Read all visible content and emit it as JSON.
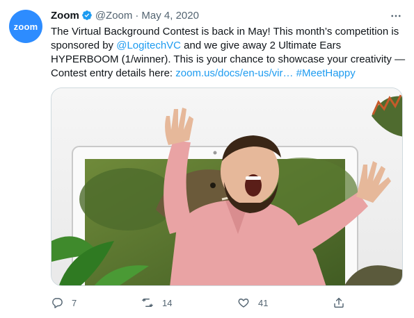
{
  "author": {
    "avatar_text": "zoom",
    "name": "Zoom",
    "handle": "@Zoom",
    "separator": "·",
    "date": "May 4, 2020"
  },
  "text": {
    "part1": "The Virtual Background Contest is back in May! This month’s competition is sponsored by ",
    "mention": "@LogitechVC",
    "part2": " and we give away 2 Ultimate Ears HYPERBOOM (1/winner). This is your chance to showcase your creativity — Contest entry details here: ",
    "url": "zoom.us/docs/en-us/vir…",
    "space": " ",
    "hashtag": "#MeetHappy"
  },
  "actions": {
    "replies": "7",
    "retweets": "14",
    "likes": "41"
  },
  "icons": {
    "verified": "verified-badge-icon",
    "more": "more-icon",
    "reply": "reply-icon",
    "retweet": "retweet-icon",
    "like": "like-icon",
    "share": "share-icon"
  },
  "colors": {
    "brand_blue": "#2d8cff",
    "link": "#1d9bf0",
    "secondary_text": "#536471"
  }
}
